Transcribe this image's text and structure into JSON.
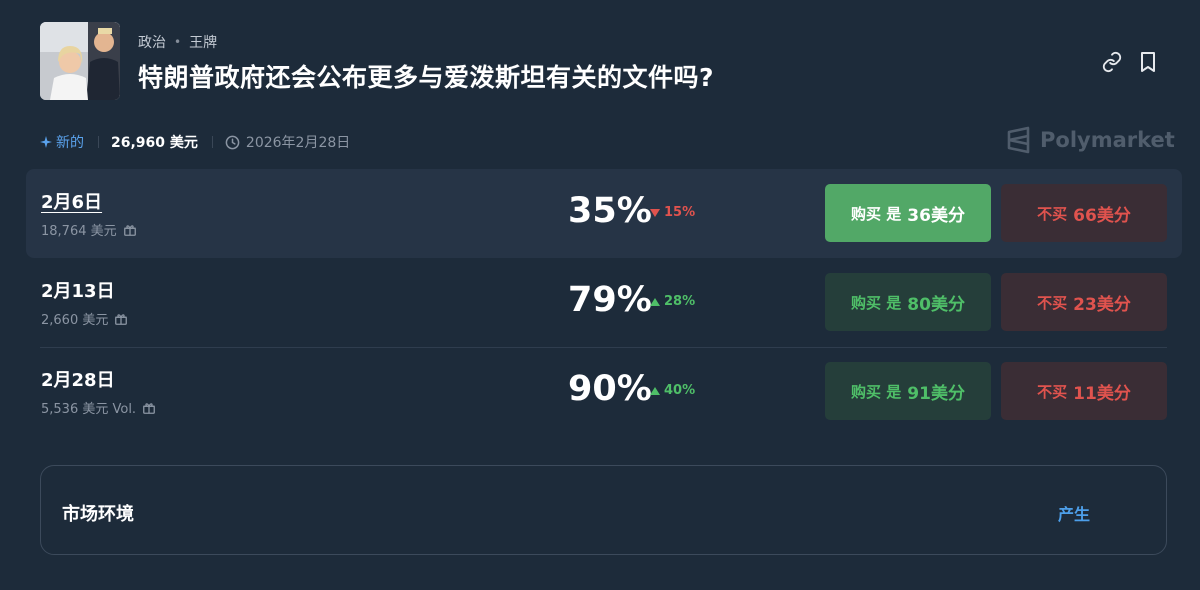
{
  "header": {
    "category": "政治",
    "tag": "王牌",
    "title": "特朗普政府还会公布更多与爱泼斯坦有关的文件吗?"
  },
  "meta": {
    "new_label": "新的",
    "volume": "26,960 美元",
    "end_date": "2026年2月28日"
  },
  "brand": "Polymarket",
  "outcomes": [
    {
      "date": "2月6日",
      "volume": "18,764 美元",
      "probability": "35%",
      "change": "15%",
      "direction": "down",
      "yes_label": "购买 是",
      "yes_price": "36美分",
      "no_label": "不买",
      "no_price": "66美分"
    },
    {
      "date": "2月13日",
      "volume": "2,660 美元",
      "probability": "79%",
      "change": "28%",
      "direction": "up",
      "yes_label": "购买 是",
      "yes_price": "80美分",
      "no_label": "不买",
      "no_price": "23美分"
    },
    {
      "date": "2月28日",
      "volume": "5,536 美元 Vol.",
      "probability": "90%",
      "change": "40%",
      "direction": "up",
      "yes_label": "购买 是",
      "yes_price": "91美分",
      "no_label": "不买",
      "no_price": "11美分"
    }
  ],
  "context": {
    "title": "市场环境",
    "action": "产生"
  },
  "colors": {
    "background": "#1d2b3a",
    "accent_blue": "#4d9fea",
    "up_green": "#4fbf68",
    "down_red": "#e0534e"
  },
  "icons": [
    "link-icon",
    "bookmark-icon",
    "sparkle-icon",
    "clock-icon",
    "gift-icon",
    "polymarket-logo-icon",
    "triangle-up-icon",
    "triangle-down-icon"
  ]
}
